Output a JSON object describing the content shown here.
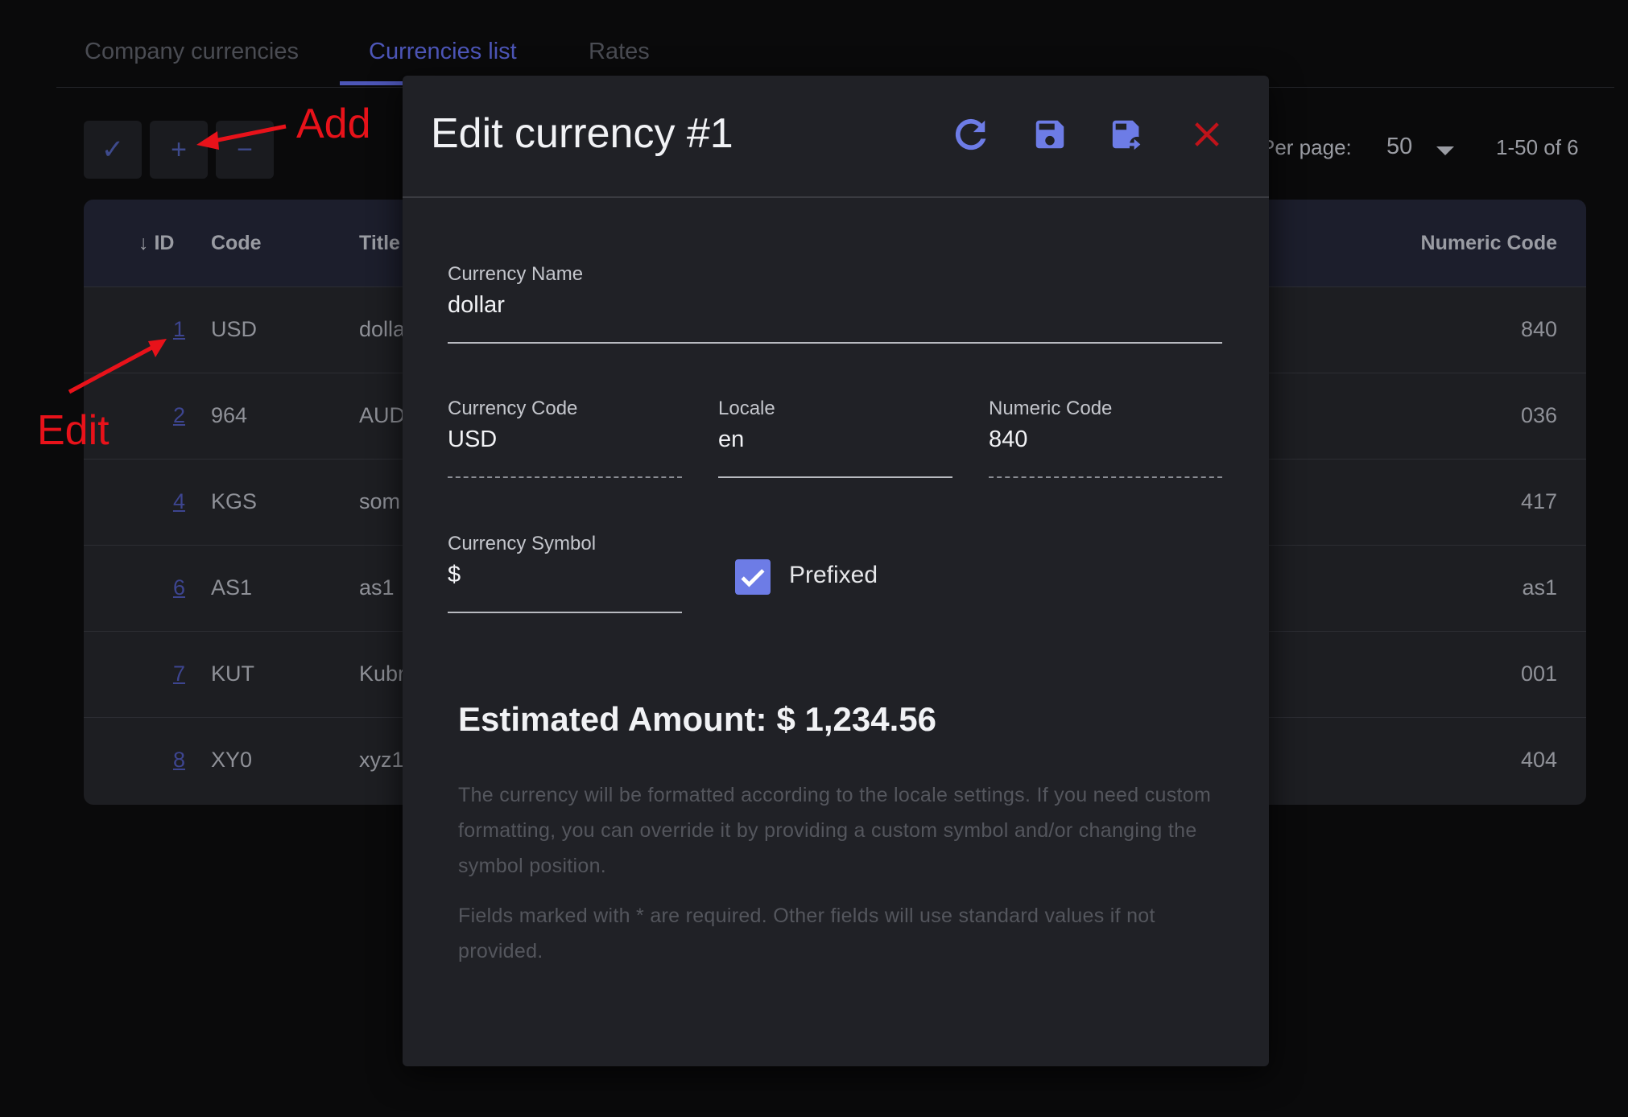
{
  "tabs": [
    {
      "label": "Company currencies"
    },
    {
      "label": "Currencies list"
    },
    {
      "label": "Rates"
    }
  ],
  "toolbar": {
    "check_glyph": "✓",
    "add_glyph": "+",
    "remove_glyph": "−",
    "per_page_label": "Per page:",
    "per_page_value": "50",
    "range": "1-50 of 6"
  },
  "table": {
    "headers": {
      "id": "ID",
      "code": "Code",
      "title": "Title",
      "numeric": "Numeric Code"
    },
    "rows": [
      {
        "id": "1",
        "code": "USD",
        "title": "dolla",
        "numeric": "840"
      },
      {
        "id": "2",
        "code": "964",
        "title": "AUD",
        "numeric": "036"
      },
      {
        "id": "4",
        "code": "KGS",
        "title": "som",
        "numeric": "417"
      },
      {
        "id": "6",
        "code": "AS1",
        "title": "as1",
        "numeric": "as1"
      },
      {
        "id": "7",
        "code": "KUT",
        "title": "Kubr",
        "numeric": "001"
      },
      {
        "id": "8",
        "code": "XY0",
        "title": "xyz1",
        "numeric": "404"
      }
    ]
  },
  "annotations": {
    "add": "Add",
    "edit": "Edit",
    "color": "#e8121a"
  },
  "modal": {
    "title": "Edit currency #1",
    "fields": {
      "name": {
        "label": "Currency Name",
        "value": "dollar"
      },
      "code": {
        "label": "Currency Code",
        "value": "USD"
      },
      "locale": {
        "label": "Locale",
        "value": "en"
      },
      "numeric": {
        "label": "Numeric Code",
        "value": "840"
      },
      "symbol": {
        "label": "Currency Symbol",
        "value": "$"
      }
    },
    "prefixed": {
      "label": "Prefixed",
      "checked": true
    },
    "estimate_label": "Estimated Amount:",
    "estimate_value": "$ 1,234.56",
    "help": [
      "The currency will be formatted according to the locale settings. If you need custom formatting, you can override it by providing a custom symbol and/or changing the symbol position.",
      "Fields marked with * are required. Other fields will use standard values if not provided."
    ]
  },
  "colors": {
    "accent": "#6d7ce6",
    "close": "#c0131a",
    "background": "#0a0a0b",
    "modal": "#202126"
  }
}
